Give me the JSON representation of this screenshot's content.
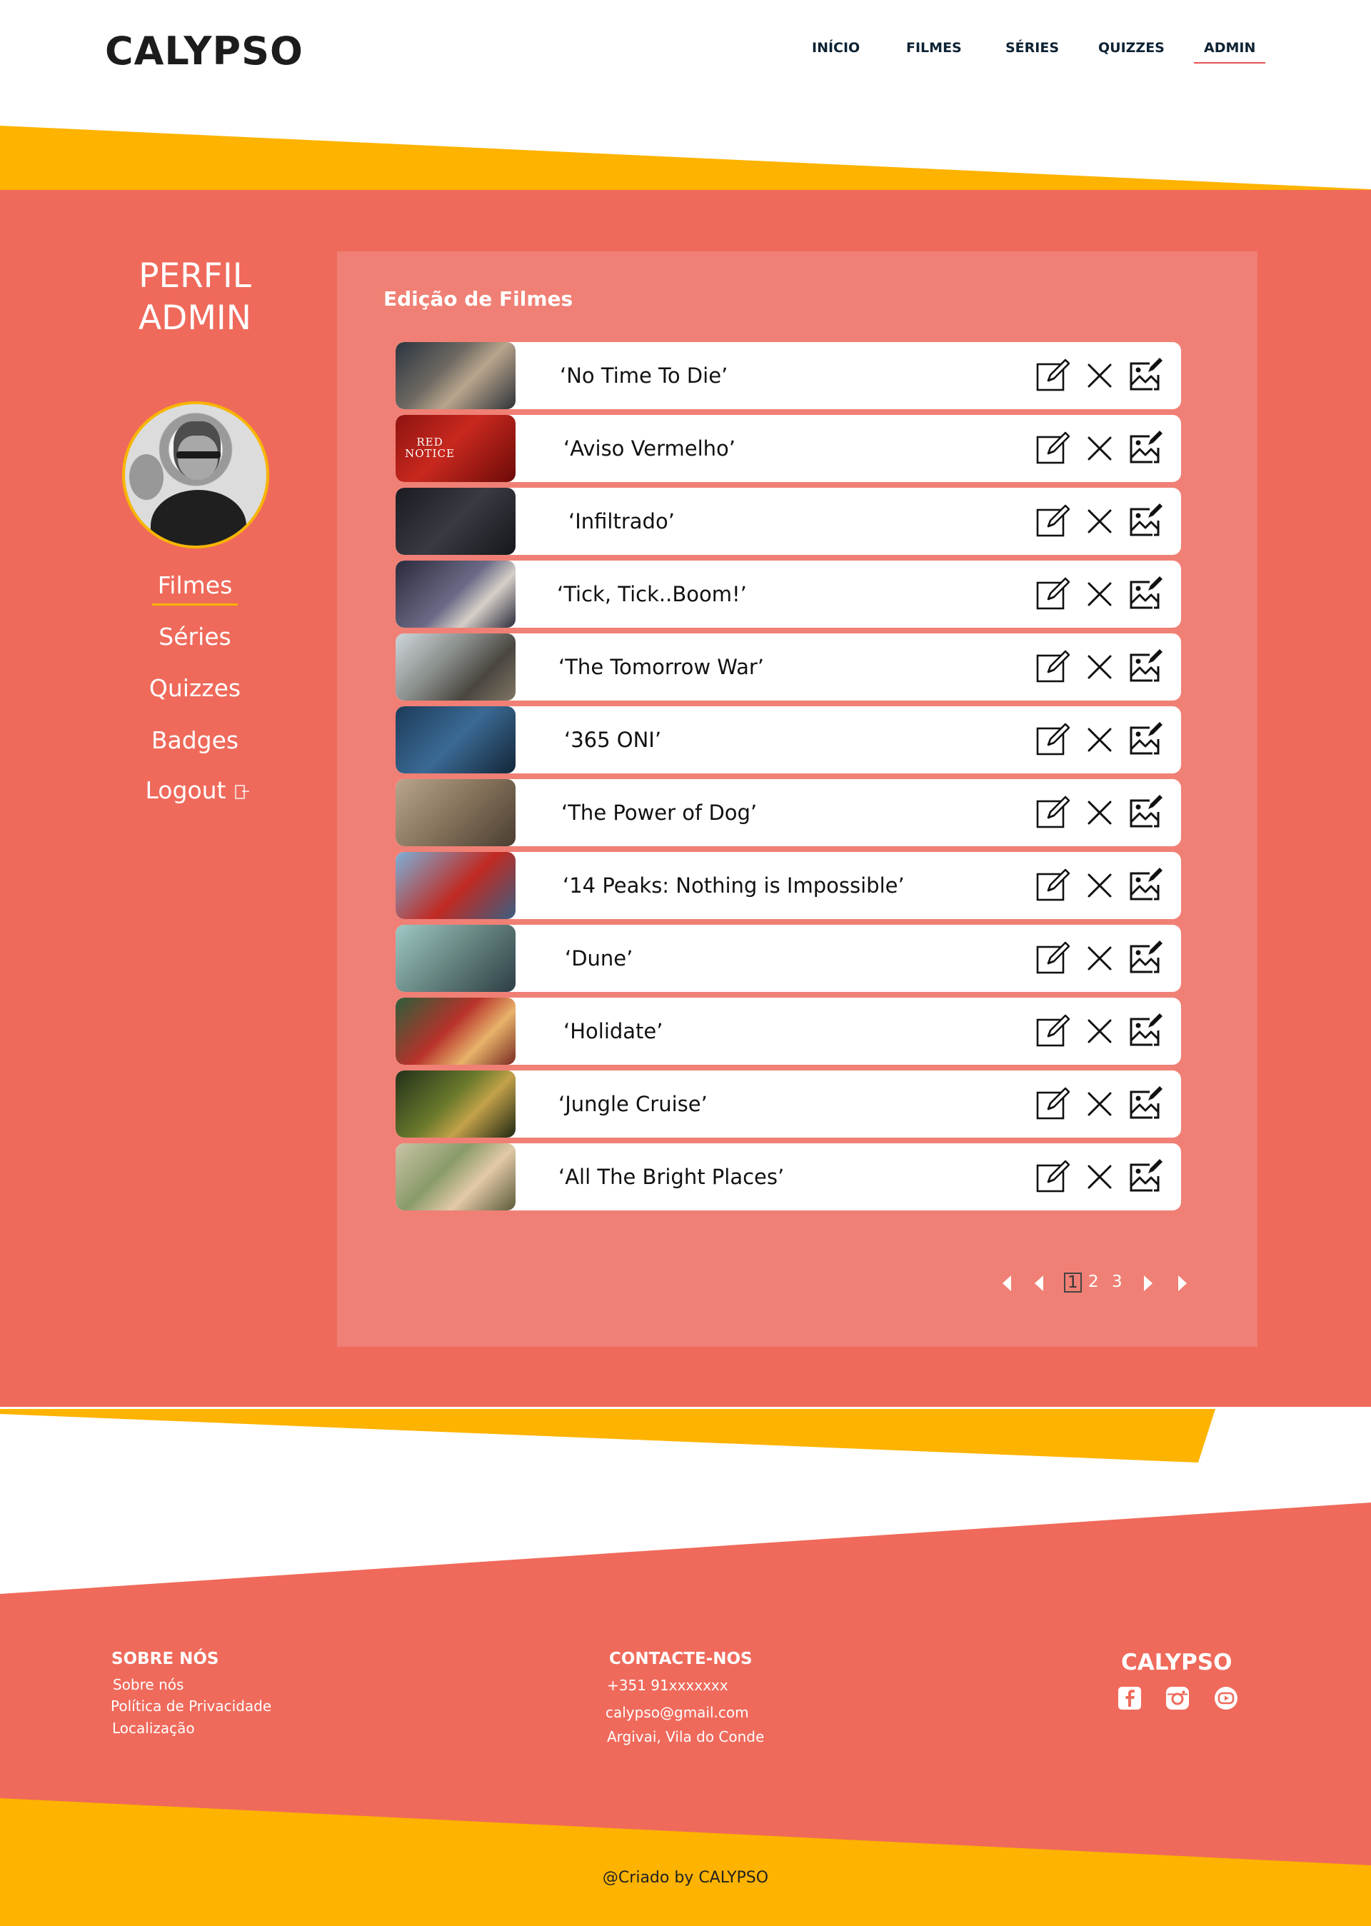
{
  "colors": {
    "coral": "#ef6a5b",
    "panel": "#f08075",
    "yellow": "#fdb300",
    "navy": "#0d2233",
    "white": "#ffffff"
  },
  "brand": {
    "logo": "CALYPSO"
  },
  "nav": {
    "items": [
      "INÍCIO",
      "FILMES",
      "SÉRIES",
      "QUIZZES",
      "ADMIN"
    ],
    "active": "ADMIN"
  },
  "sidebar": {
    "title_line1": "PERFIL",
    "title_line2": "ADMIN",
    "menu": [
      "Filmes",
      "Séries",
      "Quizzes",
      "Badges",
      "Logout"
    ],
    "active": "Filmes",
    "logout_icon": "logout-icon"
  },
  "panel": {
    "title": "Edição de Filmes",
    "actions_icons": [
      "edit-icon",
      "delete-x-icon",
      "image-edit-icon"
    ],
    "movies": [
      {
        "title": "‘No Time To Die’"
      },
      {
        "title": "‘Aviso Vermelho’"
      },
      {
        "title": "‘Infiltrado’"
      },
      {
        "title": "‘Tick, Tick..Boom!’"
      },
      {
        "title": "‘The Tomorrow War’"
      },
      {
        "title": "‘365 ONI’"
      },
      {
        "title": "‘The Power of Dog’"
      },
      {
        "title": "‘14 Peaks: Nothing is Impossible’"
      },
      {
        "title": "‘Dune’"
      },
      {
        "title": "‘Holidate’"
      },
      {
        "title": "‘Jungle Cruise’"
      },
      {
        "title": "‘All The Bright Places’"
      }
    ],
    "thumb_text": "RED NOTICE",
    "pagination": {
      "pages": [
        "1",
        "2",
        "3"
      ],
      "current": "1"
    }
  },
  "footer": {
    "about": {
      "heading": "SOBRE NÓS",
      "links": [
        "Sobre nós",
        "Política de Privacidade",
        "Localização"
      ]
    },
    "contact": {
      "heading": "CONTACTE-NOS",
      "lines": [
        "+351 91xxxxxxx",
        "calypso@gmail.com",
        "Argivai, Vila do Conde"
      ]
    },
    "brand": "CALYPSO",
    "social_icons": [
      "facebook-icon",
      "instagram-icon",
      "youtube-icon"
    ],
    "copyright": "@Criado by CALYPSO"
  }
}
